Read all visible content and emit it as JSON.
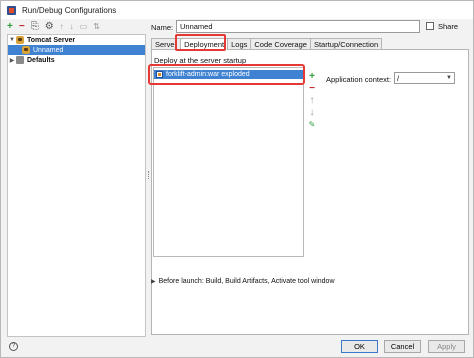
{
  "window": {
    "title": "Run/Debug Configurations"
  },
  "toolbar": {
    "add": "+",
    "remove": "−",
    "copy": "⎘",
    "settings": "⚙",
    "up": "↑",
    "down": "↓",
    "folder": "▭",
    "sort": "⇅"
  },
  "tree": {
    "items": [
      {
        "label": "Tomcat Server",
        "bold": true,
        "expanded": true,
        "icon": "tomcat-icon"
      },
      {
        "label": "Unnamed",
        "selected": true,
        "icon": "tomcat-icon"
      },
      {
        "label": "Defaults",
        "bold": true,
        "expanded": false,
        "icon": "defaults-icon"
      }
    ]
  },
  "name_field": {
    "label": "Name:",
    "value": "Unnamed"
  },
  "share": {
    "label": "Share",
    "checked": false
  },
  "tabs": [
    "Server",
    "Deployment",
    "Logs",
    "Code Coverage",
    "Startup/Connection"
  ],
  "active_tab": "Deployment",
  "deployment": {
    "section_label": "Deploy at the server startup",
    "items": [
      "forklift-admin:war exploded"
    ],
    "side_tools": {
      "add": "+",
      "remove": "−",
      "up": "↑",
      "down": "↓",
      "edit": "✎"
    },
    "app_context_label": "Application context:",
    "app_context_value": "/"
  },
  "before_launch": "Before launch: Build, Build Artifacts, Activate tool window",
  "buttons": {
    "ok": "OK",
    "cancel": "Cancel",
    "apply": "Apply"
  },
  "help": "?",
  "colors": {
    "selection": "#3f82d1",
    "highlight_outline": "#e53935",
    "add_green": "#2e9d3a",
    "remove_red": "#c62828"
  }
}
